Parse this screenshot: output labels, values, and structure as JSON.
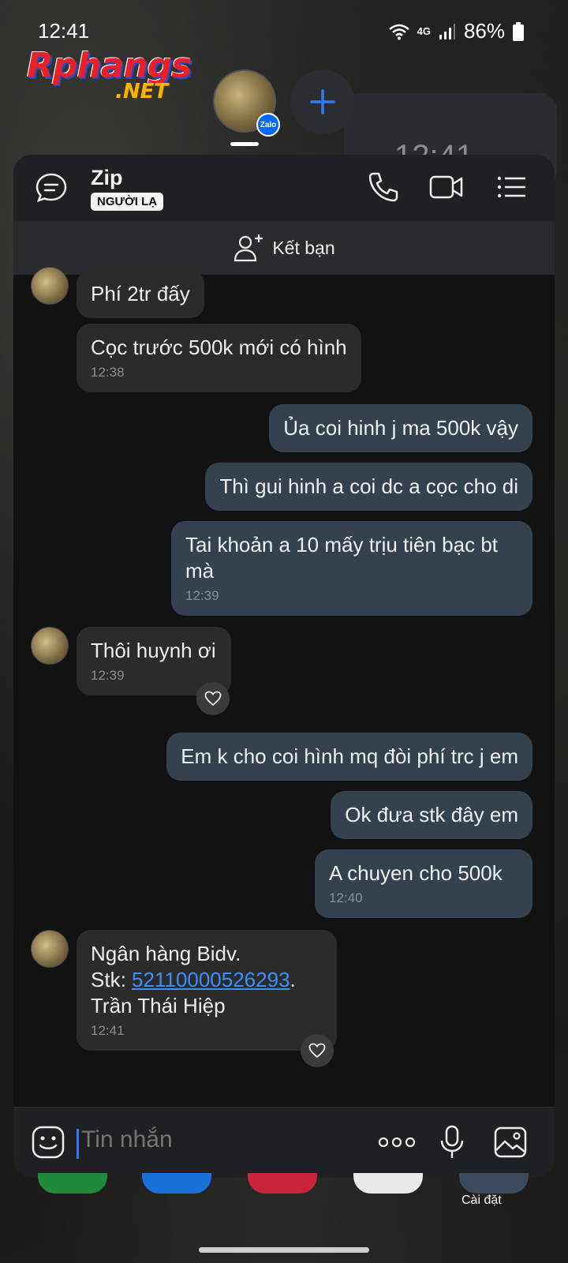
{
  "status_bar": {
    "time": "12:41",
    "network": "4G",
    "battery": "86%"
  },
  "watermark": {
    "brand": "Rphangs",
    "domain": ".NET"
  },
  "bubbles": {
    "badge": "Zalo",
    "ghost_time": "12:41"
  },
  "header": {
    "title": "Zip",
    "badge": "NGƯỜI LẠ"
  },
  "add_friend": {
    "label": "Kết bạn"
  },
  "messages": [
    {
      "dir": "in",
      "text": "Phí 2tr đấy",
      "time": ""
    },
    {
      "dir": "in",
      "text": "Cọc trước 500k mới có hình",
      "time": "12:38"
    },
    {
      "dir": "out",
      "text": "Ủa coi hinh j ma 500k vậy",
      "time": ""
    },
    {
      "dir": "out",
      "text": "Thì gui hinh a coi dc a cọc cho di",
      "time": ""
    },
    {
      "dir": "out",
      "text": "Tai khoản a 10 mấy trịu tiên bạc bt mà",
      "time": "12:39"
    },
    {
      "dir": "in",
      "text": "Thôi huynh ơi",
      "time": "12:39"
    },
    {
      "dir": "out",
      "text": "Em k cho coi hình mq đòi phí trc j em",
      "time": ""
    },
    {
      "dir": "out",
      "text": "Ok đưa stk đây em",
      "time": ""
    },
    {
      "dir": "out",
      "text": "A chuyen cho 500k",
      "time": "12:40"
    },
    {
      "dir": "in",
      "line1": "Ngân hàng Bidv.",
      "line2_prefix": "Stk: ",
      "account": "52110000526293",
      "line2_suffix": ".",
      "line3": "Trần Thái Hiệp",
      "time": "12:41"
    }
  ],
  "composer": {
    "placeholder": "Tin nhắn"
  },
  "dock": {
    "settings_label": "Cài đặt"
  }
}
